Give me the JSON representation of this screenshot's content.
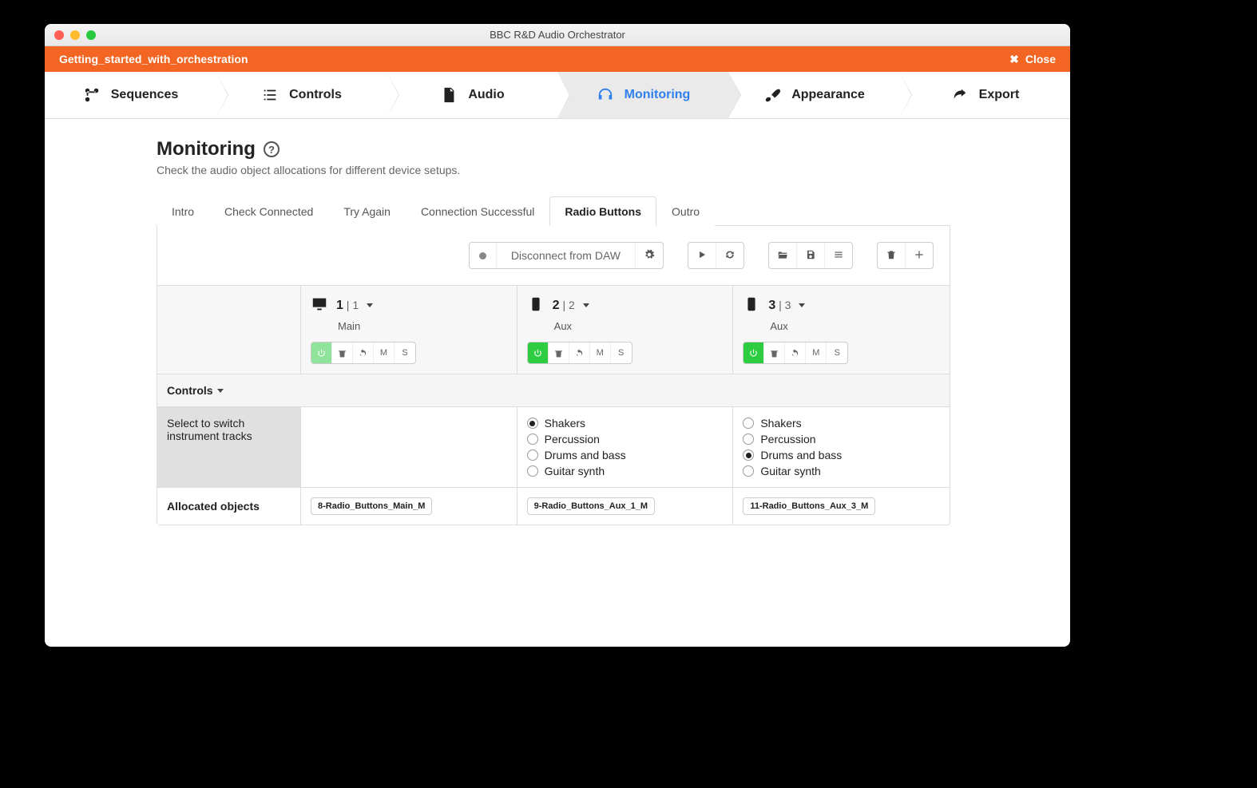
{
  "window": {
    "title": "BBC R&D Audio Orchestrator"
  },
  "project_bar": {
    "name": "Getting_started_with_orchestration",
    "close": "Close"
  },
  "main_nav": {
    "items": [
      {
        "label": "Sequences"
      },
      {
        "label": "Controls"
      },
      {
        "label": "Audio"
      },
      {
        "label": "Monitoring",
        "active": true
      },
      {
        "label": "Appearance"
      },
      {
        "label": "Export"
      }
    ]
  },
  "page": {
    "title": "Monitoring",
    "subtitle": "Check the audio object allocations for different device setups."
  },
  "subtabs": {
    "items": [
      {
        "label": "Intro"
      },
      {
        "label": "Check Connected"
      },
      {
        "label": "Try Again"
      },
      {
        "label": "Connection Successful"
      },
      {
        "label": "Radio Buttons",
        "active": true
      },
      {
        "label": "Outro"
      }
    ]
  },
  "toolbar": {
    "daw_label": "Disconnect from DAW"
  },
  "devices": [
    {
      "num": "1",
      "idx": "1",
      "name": "Main",
      "kind": "desktop",
      "power_light": true
    },
    {
      "num": "2",
      "idx": "2",
      "name": "Aux",
      "kind": "phone",
      "power_light": false
    },
    {
      "num": "3",
      "idx": "3",
      "name": "Aux",
      "kind": "phone",
      "power_light": false
    }
  ],
  "controls_row": {
    "label": "Controls"
  },
  "instrument_row": {
    "label": "Select to switch instrument tracks",
    "options": [
      "Shakers",
      "Percussion",
      "Drums and bass",
      "Guitar synth"
    ],
    "selected": [
      null,
      0,
      2
    ]
  },
  "allocated_row": {
    "label": "Allocated objects",
    "pills": [
      "8-Radio_Buttons_Main_M",
      "9-Radio_Buttons_Aux_1_M",
      "11-Radio_Buttons_Aux_3_M"
    ]
  }
}
